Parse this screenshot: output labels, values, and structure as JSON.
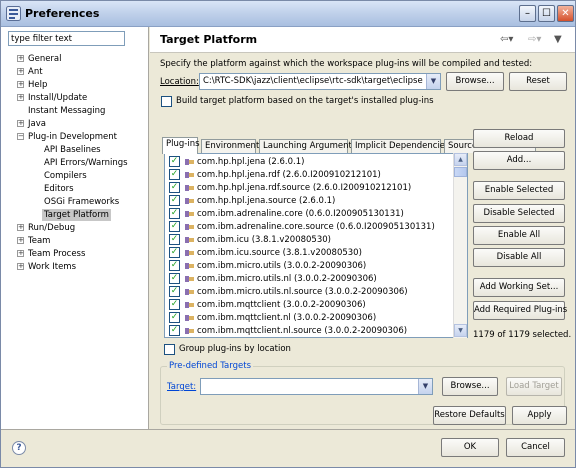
{
  "window": {
    "title": "Preferences",
    "min": "–",
    "max": "☐",
    "close": "✕"
  },
  "filter": {
    "placeholder": "type filter text",
    "value": "type filter text"
  },
  "tree": {
    "general": "General",
    "ant": "Ant",
    "help": "Help",
    "install_update": "Install/Update",
    "instant_messaging": "Instant Messaging",
    "java": "Java",
    "plugin_development": "Plug-in Development",
    "api_baselines": "API Baselines",
    "api_errors": "API Errors/Warnings",
    "compilers": "Compilers",
    "editors": "Editors",
    "osgi_frameworks": "OSGi Frameworks",
    "target_platform": "Target Platform",
    "run_debug": "Run/Debug",
    "team": "Team",
    "team_process": "Team Process",
    "work_items": "Work Items",
    "expand_plus": "+",
    "expand_minus": "−"
  },
  "page": {
    "title": "Target Platform",
    "description": "Specify the platform against which the workspace plug-ins will be compiled and tested:",
    "location_label": "Location:",
    "location_value": "C:\\RTC-SDK\\jazz\\client\\eclipse\\rtc-sdk\\target\\eclipse",
    "browse_button": "Browse...",
    "reset_button": "Reset",
    "build_target_label": "Build target platform based on the target's installed plug-ins",
    "tabs": [
      "Plug-ins",
      "Environment",
      "Launching Arguments",
      "Implicit Dependencies",
      "Source Code Locations"
    ],
    "plugins": [
      "com.hp.hpl.jena (2.6.0.1)",
      "com.hp.hpl.jena.rdf (2.6.0.I200910212101)",
      "com.hp.hpl.jena.rdf.source (2.6.0.I200910212101)",
      "com.hp.hpl.jena.source (2.6.0.1)",
      "com.ibm.adrenaline.core (0.6.0.I200905130131)",
      "com.ibm.adrenaline.core.source (0.6.0.I200905130131)",
      "com.ibm.icu (3.8.1.v20080530)",
      "com.ibm.icu.source (3.8.1.v20080530)",
      "com.ibm.micro.utils (3.0.0.2-20090306)",
      "com.ibm.micro.utils.nl (3.0.0.2-20090306)",
      "com.ibm.micro.utils.nl.source (3.0.0.2-20090306)",
      "com.ibm.mqttclient (3.0.0.2-20090306)",
      "com.ibm.mqttclient.nl (3.0.0.2-20090306)",
      "com.ibm.mqttclient.nl.source (3.0.0.2-20090306)"
    ],
    "side_buttons": {
      "reload": "Reload",
      "add": "Add...",
      "enable_selected": "Enable Selected",
      "disable_selected": "Disable Selected",
      "enable_all": "Enable All",
      "disable_all": "Disable All",
      "add_working_set": "Add Working Set...",
      "add_required": "Add Required Plug-ins"
    },
    "selected_count": "1179 of 1179 selected.",
    "group_by_location": "Group plug-ins by location",
    "predefined_group": "Pre-defined Targets",
    "target_label": "Target:",
    "target_value": "",
    "target_browse": "Browse...",
    "load_target": "Load Target",
    "restore_defaults": "Restore Defaults",
    "apply": "Apply"
  },
  "footer": {
    "help": "?",
    "ok": "OK",
    "cancel": "Cancel"
  },
  "colors": {
    "accent": "#1c5180",
    "title_gradient": "#bfd0ea",
    "check_green": "#21a121"
  }
}
